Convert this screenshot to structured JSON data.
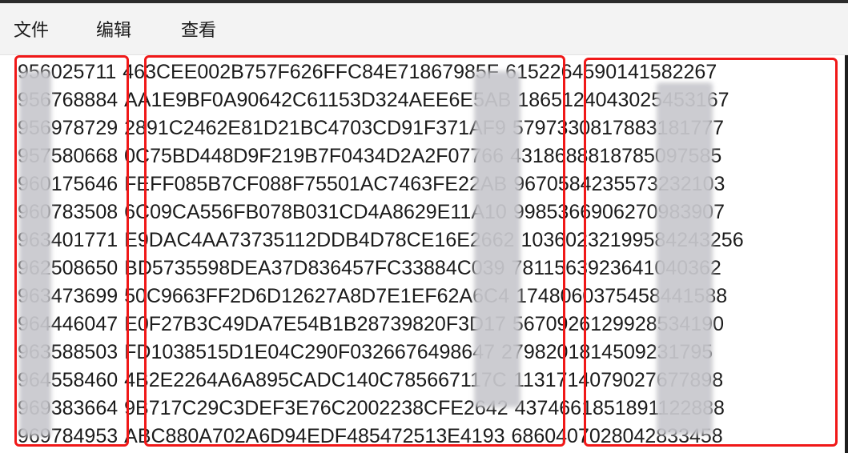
{
  "menu": {
    "file": "文件",
    "edit": "编辑",
    "view": "查看"
  },
  "rows": [
    {
      "c1": "956025711",
      "c2": "463CEE002B757F626FFC84E71867985F",
      "c3": "6152264590141582267"
    },
    {
      "c1": "956768884",
      "c2": "AA1E9BF0A90642C61153D324AEE6E5AB",
      "c3": "1865124043025453167"
    },
    {
      "c1": "956978729",
      "c2": "2891C2462E81D21BC4703CD91F371AF9",
      "c3": "5797330817883181777"
    },
    {
      "c1": "957580668",
      "c2": "0C75BD448D9F219B7F0434D2A2F07766",
      "c3": "4318688818785097585"
    },
    {
      "c1": "960175646",
      "c2": "FEFF085B7CF088F75501AC7463FE22AB",
      "c3": "9670584235573232103"
    },
    {
      "c1": "960783508",
      "c2": "6C09CA556FB078B031CD4A8629E11A10",
      "c3": "9985366906270983907"
    },
    {
      "c1": "963401771",
      "c2": "E9DAC4AA73735112DDB4D78CE16E2662",
      "c3": "10360232199584243256"
    },
    {
      "c1": "962508650",
      "c2": "BD5735598DEA37D836457FC33884C039",
      "c3": "7811563923641040362"
    },
    {
      "c1": "963473699",
      "c2": "50C9663FF2D6D12627A8D7E1EF62A6C4",
      "c3": "1748060375458441588"
    },
    {
      "c1": "964446047",
      "c2": "E0F27B3C49DA7E54B1B28739820F3D17",
      "c3": "5670926129928534190"
    },
    {
      "c1": "963588503",
      "c2": "FD1038515D1E04C290F0326676498647",
      "c3": "2798201814509231795"
    },
    {
      "c1": "964558460",
      "c2": "4B2E2264A6A895CADC140C785667117C",
      "c3": "1131714079027677898"
    },
    {
      "c1": "969383664",
      "c2": "9B717C29C3DEF3E76C2002238CFE2642",
      "c3": "4374661851891122888"
    },
    {
      "c1": "969784953",
      "c2": "ABC880A702A6D94EDF485472513E4193",
      "c3": "6860407028042833458"
    }
  ]
}
